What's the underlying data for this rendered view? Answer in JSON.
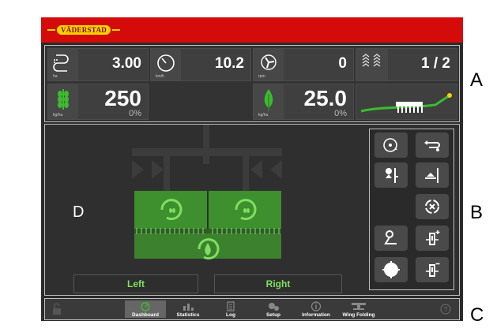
{
  "brand": {
    "logo_text": "VÄDERSTAD"
  },
  "colors": {
    "brand_red": "#d50b0b",
    "accent_green": "#3dbb2f",
    "label_green": "#7fe05f",
    "panel": "#3f3f3f"
  },
  "info_panel": {
    "area_unit": "ha",
    "area_value": "3.00",
    "speed_unit": "km/h",
    "speed_value": "10.2",
    "fan_unit": "rpm",
    "fan_value": "0",
    "rows_value": "1 / 2",
    "seed_unit": "kg/ha",
    "seed_value": "250",
    "seed_pct": "0%",
    "fert_unit": "kg/ha",
    "fert_value": "25.0",
    "fert_pct": "0%"
  },
  "main_view": {
    "section_label": "D",
    "left_button": "Left",
    "right_button": "Right"
  },
  "side_labels": {
    "a": "A",
    "b": "B",
    "c": "C"
  },
  "nav": {
    "items": [
      {
        "label": "Dashboard",
        "icon": "dashboard-icon"
      },
      {
        "label": "Statistics",
        "icon": "statistics-icon"
      },
      {
        "label": "Log",
        "icon": "log-icon"
      },
      {
        "label": "Setup",
        "icon": "setup-icon"
      },
      {
        "label": "Information",
        "icon": "information-icon"
      },
      {
        "label": "Wing Folding",
        "icon": "wing-folding-icon"
      }
    ],
    "active": "Dashboard"
  }
}
